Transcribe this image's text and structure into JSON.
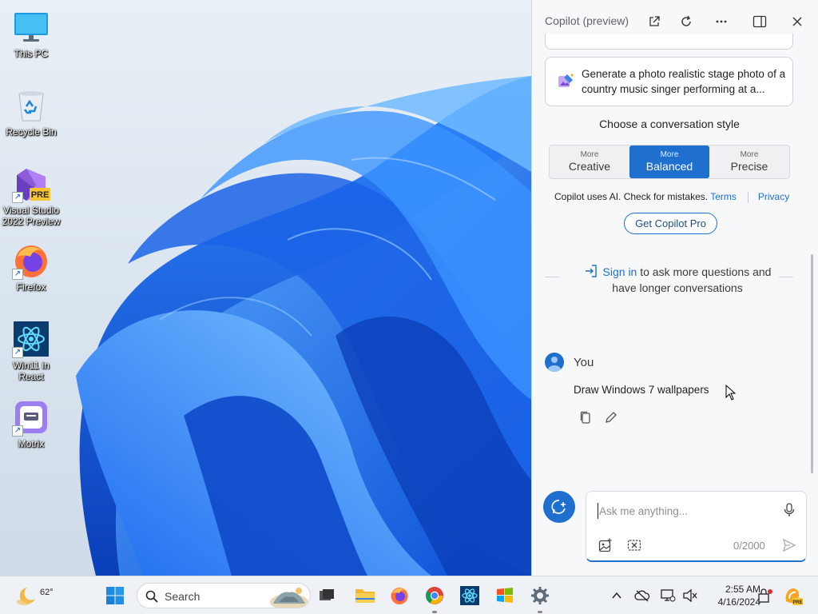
{
  "desktop": {
    "icons": [
      {
        "label": "This PC",
        "icon": "monitor-icon"
      },
      {
        "label": "Recycle Bin",
        "icon": "recycle-bin-icon"
      },
      {
        "label": "Visual Studio 2022 Preview",
        "icon": "visual-studio-icon",
        "badge": "PRE"
      },
      {
        "label": "Firefox",
        "icon": "firefox-icon"
      },
      {
        "label": "Win11 in React",
        "icon": "react-icon"
      },
      {
        "label": "Motrix",
        "icon": "motrix-icon"
      }
    ]
  },
  "copilot": {
    "title": "Copilot (preview)",
    "header_buttons": [
      "open-external-icon",
      "refresh-icon",
      "more-icon",
      "split-view-icon",
      "close-icon"
    ],
    "suggestion": "Generate a photo realistic stage photo of a country music singer performing at a...",
    "conversation_style_label": "Choose a conversation style",
    "styles": [
      {
        "small": "More",
        "big": "Creative"
      },
      {
        "small": "More",
        "big": "Balanced",
        "active": true
      },
      {
        "small": "More",
        "big": "Precise"
      }
    ],
    "disclaimer": "Copilot uses AI. Check for mistakes.",
    "terms_link": "Terms",
    "privacy_link": "Privacy",
    "get_pro": "Get Copilot Pro",
    "signin_link": "Sign in",
    "signin_text": " to ask more questions and have longer conversations",
    "you_label": "You",
    "user_message": "Draw Windows 7 wallpapers",
    "input_placeholder": "Ask me anything...",
    "char_count": "0/2000",
    "accent": "#1f6fcf"
  },
  "taskbar": {
    "weather_temp": "62°",
    "search_label": "Search",
    "time": "2:55 AM",
    "date": "4/16/2024",
    "apps": [
      "start-icon",
      "task-view-icon",
      "file-explorer-icon",
      "firefox-icon",
      "chrome-icon",
      "react-icon",
      "windows-7-icon",
      "settings-icon"
    ],
    "tray": [
      "chevron-up-icon",
      "onedrive-icon",
      "network-icon",
      "volume-icon",
      "security-icon",
      "copilot-icon"
    ]
  }
}
